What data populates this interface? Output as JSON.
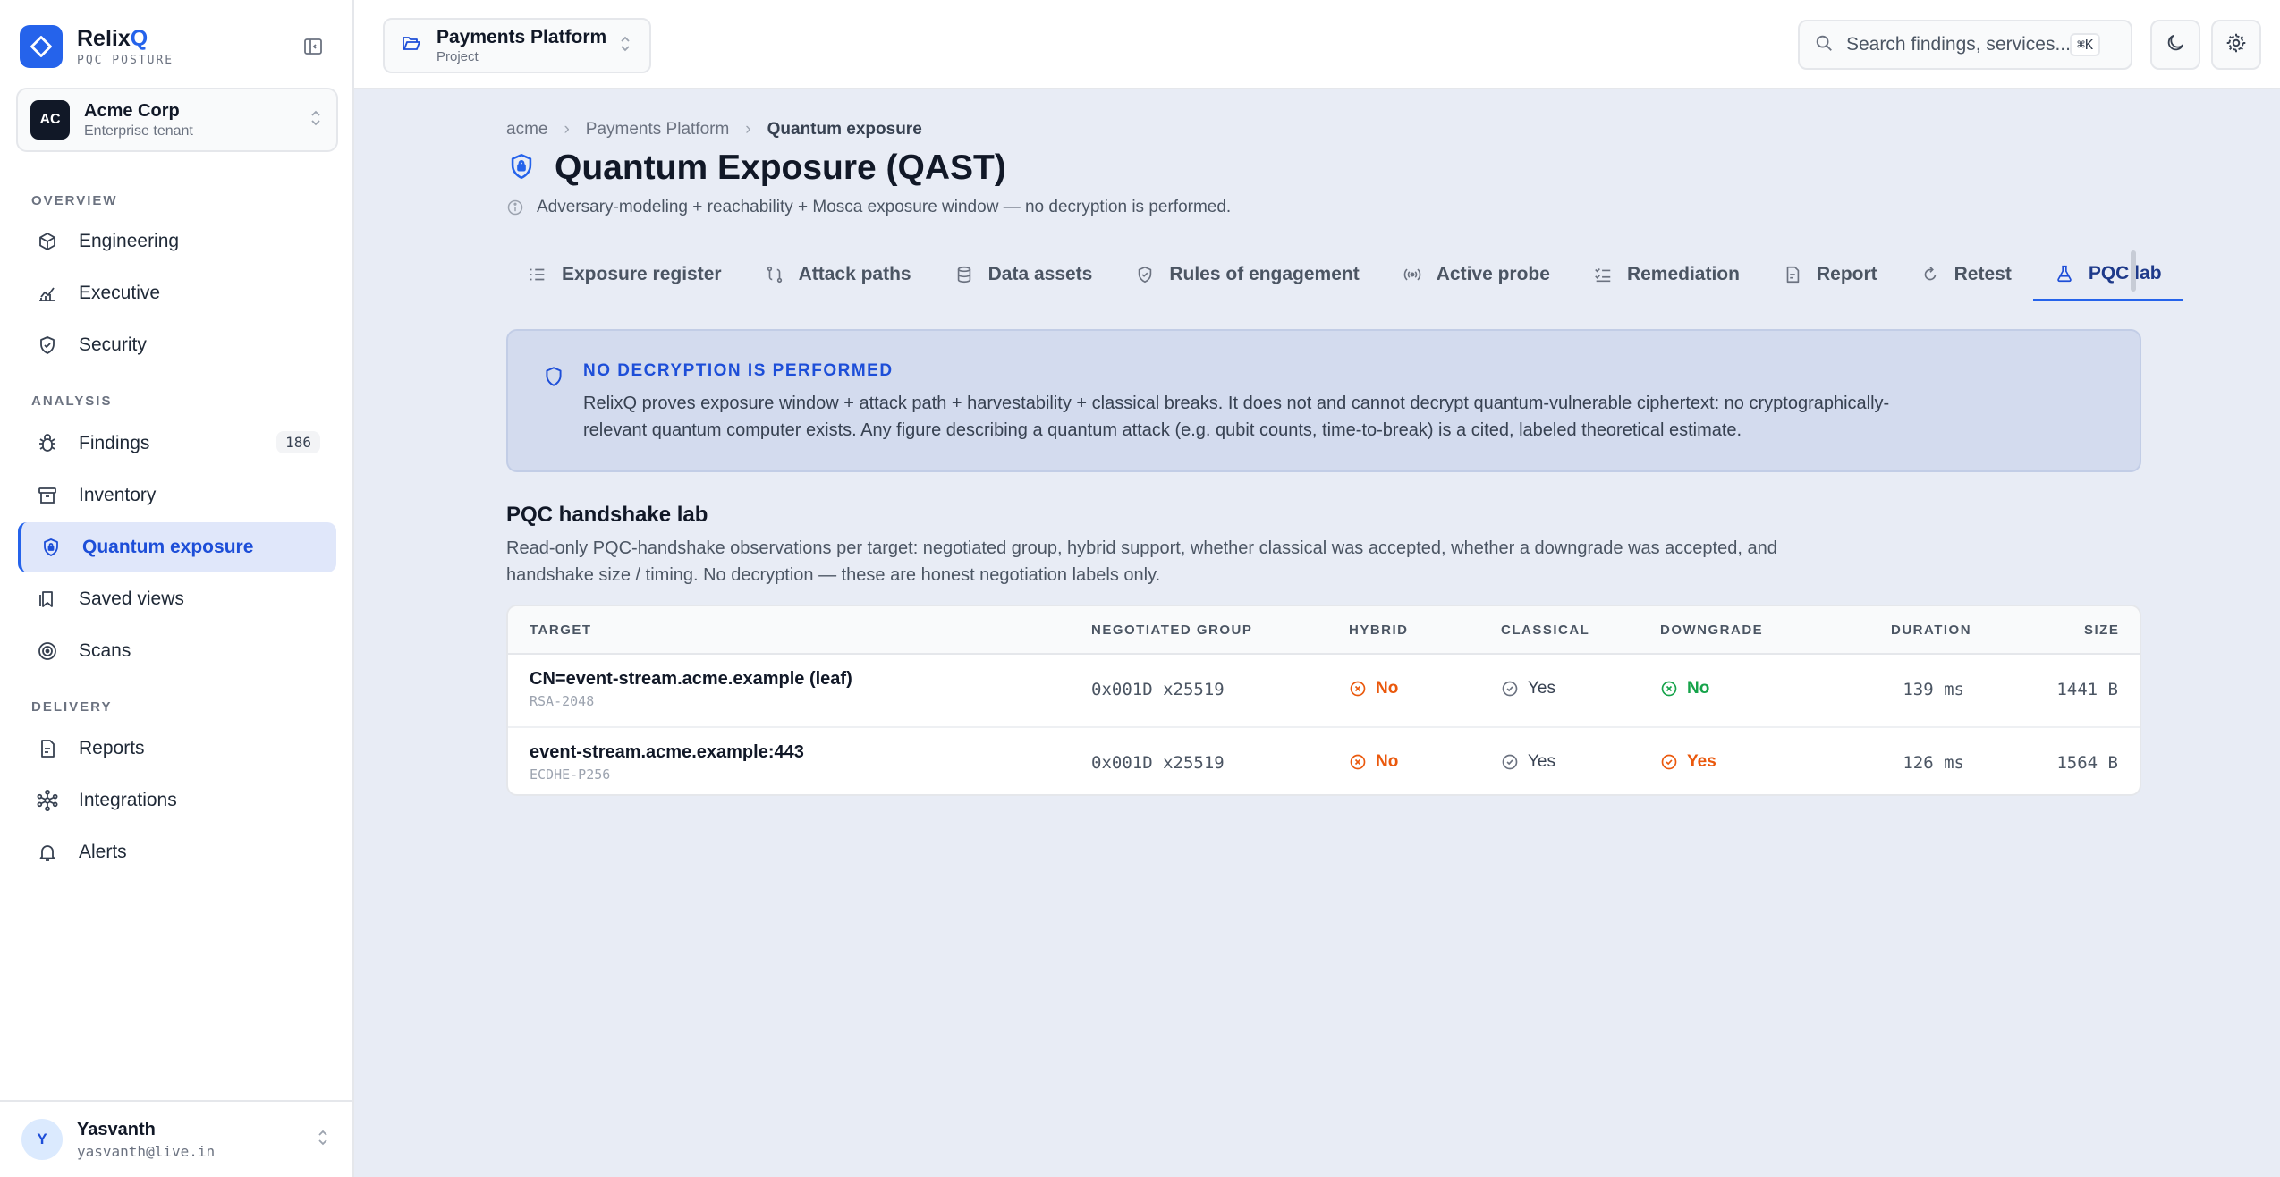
{
  "brand": {
    "name_prefix": "Relix",
    "name_accent": "Q",
    "subtitle": "PQC POSTURE"
  },
  "tenant": {
    "initials": "AC",
    "name": "Acme Corp",
    "type": "Enterprise tenant"
  },
  "sidebar": {
    "sections": [
      {
        "label": "OVERVIEW"
      },
      {
        "label": "ANALYSIS"
      },
      {
        "label": "DELIVERY"
      }
    ],
    "items": [
      {
        "label": "Engineering",
        "icon": "cube-icon"
      },
      {
        "label": "Executive",
        "icon": "chart-icon"
      },
      {
        "label": "Security",
        "icon": "shield-check-icon"
      },
      {
        "label": "Findings",
        "icon": "bug-icon",
        "badge": "186"
      },
      {
        "label": "Inventory",
        "icon": "archive-icon"
      },
      {
        "label": "Quantum exposure",
        "icon": "shield-lock-icon",
        "active": true
      },
      {
        "label": "Saved views",
        "icon": "bookmark-icon"
      },
      {
        "label": "Scans",
        "icon": "target-icon"
      },
      {
        "label": "Reports",
        "icon": "report-icon"
      },
      {
        "label": "Integrations",
        "icon": "network-icon"
      },
      {
        "label": "Alerts",
        "icon": "bell-icon"
      }
    ]
  },
  "user": {
    "initial": "Y",
    "name": "Yasvanth",
    "email": "yasvanth@live.in"
  },
  "topbar": {
    "project": {
      "name": "Payments Platform",
      "type": "Project"
    },
    "search": {
      "placeholder": "Search findings, services...",
      "shortcut": "⌘K"
    }
  },
  "breadcrumb": {
    "items": [
      "acme",
      "Payments Platform",
      "Quantum exposure"
    ]
  },
  "page": {
    "title": "Quantum Exposure (QAST)",
    "subtitle": "Adversary-modeling + reachability + Mosca exposure window — no decryption is performed."
  },
  "tabs": [
    {
      "label": "Exposure register",
      "icon": "list-icon"
    },
    {
      "label": "Attack paths",
      "icon": "path-icon"
    },
    {
      "label": "Data assets",
      "icon": "database-icon"
    },
    {
      "label": "Rules of engagement",
      "icon": "shield-check-icon"
    },
    {
      "label": "Active probe",
      "icon": "radio-icon"
    },
    {
      "label": "Remediation",
      "icon": "checklist-icon"
    },
    {
      "label": "Report",
      "icon": "document-icon"
    },
    {
      "label": "Retest",
      "icon": "refresh-icon"
    },
    {
      "label": "PQC lab",
      "icon": "flask-icon",
      "active": true
    }
  ],
  "notice": {
    "title": "NO DECRYPTION IS PERFORMED",
    "body": "RelixQ proves exposure window + attack path + harvestability + classical breaks. It does not and cannot decrypt quantum-vulnerable ciphertext: no cryptographically-relevant quantum computer exists. Any figure describing a quantum attack (e.g. qubit counts, time-to-break) is a cited, labeled theoretical estimate."
  },
  "lab": {
    "title": "PQC handshake lab",
    "description": "Read-only PQC-handshake observations per target: negotiated group, hybrid support, whether classical was accepted, whether a downgrade was accepted, and handshake size / timing. No decryption — these are honest negotiation labels only.",
    "columns": {
      "target": "TARGET",
      "group": "NEGOTIATED GROUP",
      "hybrid": "HYBRID",
      "classical": "CLASSICAL",
      "downgrade": "DOWNGRADE",
      "duration": "DURATION",
      "size": "SIZE"
    },
    "rows": [
      {
        "target": "CN=event-stream.acme.example (leaf)",
        "target_sub": "RSA-2048",
        "group": "0x001D x25519",
        "hybrid": "No",
        "classical": "Yes",
        "downgrade": "No",
        "duration": "139 ms",
        "size": "1441 B"
      },
      {
        "target": "event-stream.acme.example:443",
        "target_sub": "ECDHE-P256",
        "group": "0x001D x25519",
        "hybrid": "No",
        "classical": "Yes",
        "downgrade": "Yes",
        "duration": "126 ms",
        "size": "1564 B"
      }
    ]
  },
  "colors": {
    "accent": "#2563eb",
    "warning": "#ea580c",
    "success": "#16a34a",
    "notice_bg": "#d3dbee"
  }
}
